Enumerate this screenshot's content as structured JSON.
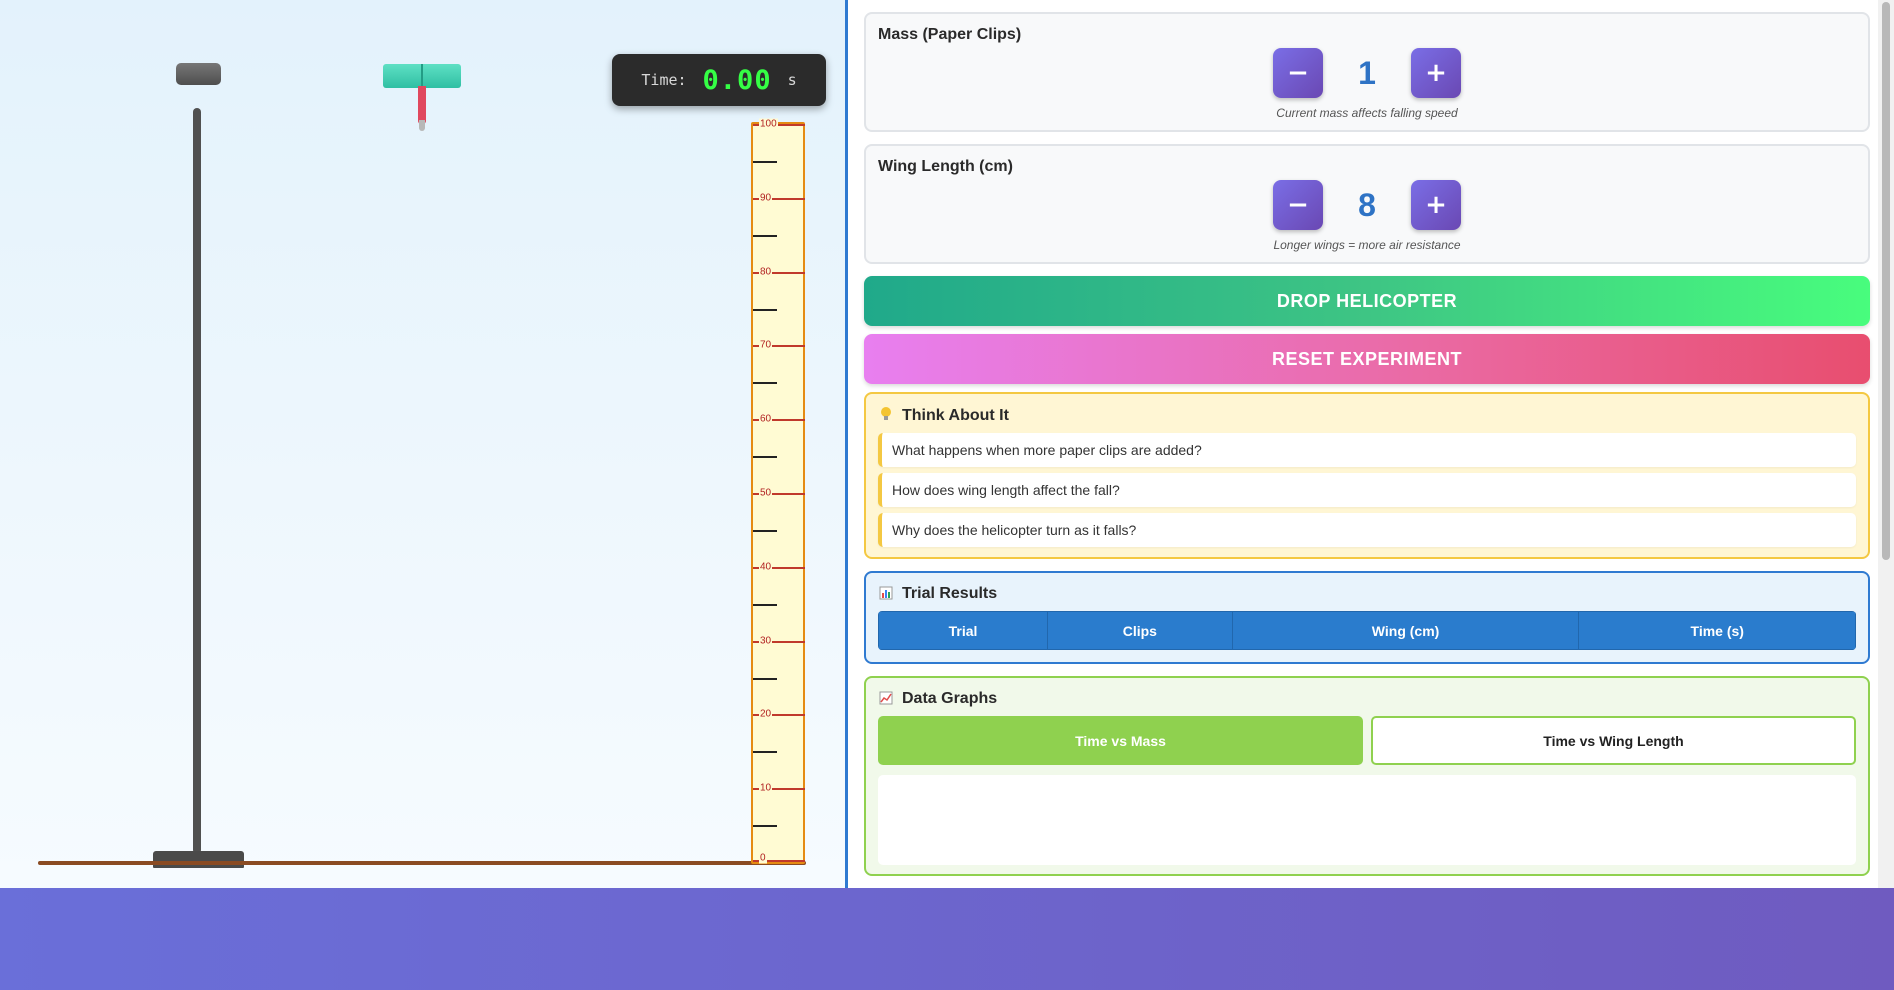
{
  "timer": {
    "label": "Time:",
    "value": "0.00",
    "unit": "s"
  },
  "ruler": {
    "labels": [
      "100",
      "90",
      "80",
      "70",
      "60",
      "50",
      "40",
      "30",
      "20",
      "10",
      "0"
    ]
  },
  "mass": {
    "title": "Mass (Paper Clips)",
    "value": "1",
    "minus": "−",
    "plus": "+",
    "hint": "Current mass affects falling speed"
  },
  "wing": {
    "title": "Wing Length (cm)",
    "value": "8",
    "minus": "−",
    "plus": "+",
    "hint": "Longer wings = more air resistance"
  },
  "buttons": {
    "drop": "DROP HELICOPTER",
    "reset": "RESET EXPERIMENT"
  },
  "think": {
    "icon": "lightbulb-icon",
    "title": "Think About It",
    "questions": [
      "What happens when more paper clips are added?",
      "How does wing length affect the fall?",
      "Why does the helicopter turn as it falls?"
    ]
  },
  "results": {
    "icon": "bar-chart-icon",
    "title": "Trial Results",
    "columns": [
      "Trial",
      "Clips",
      "Wing (cm)",
      "Time (s)"
    ]
  },
  "graphs": {
    "icon": "line-chart-icon",
    "title": "Data Graphs",
    "tabs": [
      "Time vs Mass",
      "Time vs Wing Length"
    ],
    "active_tab": "Time vs Mass"
  }
}
